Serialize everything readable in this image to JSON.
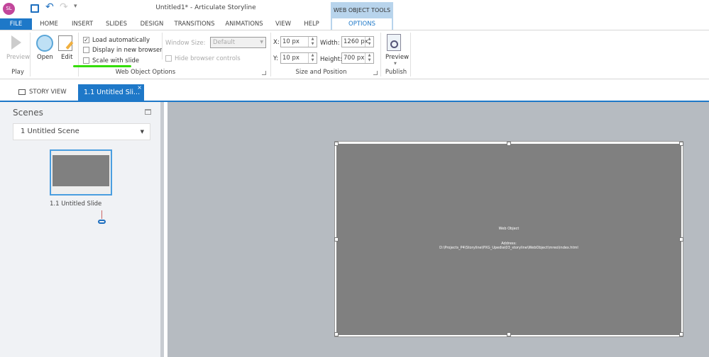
{
  "titlebar": {
    "logo": "SL",
    "title": "Untitled1* -  Articulate Storyline",
    "icons": [
      "save-icon",
      "undo-icon",
      "redo-icon",
      "customize-icon"
    ]
  },
  "contextual_header": "WEB OBJECT TOOLS",
  "tabs": [
    "FILE",
    "HOME",
    "INSERT",
    "SLIDES",
    "DESIGN",
    "TRANSITIONS",
    "ANIMATIONS",
    "VIEW",
    "HELP",
    "OPTIONS"
  ],
  "ribbon": {
    "preview": "Preview",
    "play_group": "Play",
    "open": "Open",
    "edit": "Edit",
    "load_auto": "Load automatically",
    "load_auto_checked": true,
    "new_browser": "Display in new browser",
    "new_browser_checked": false,
    "scale": "Scale with slide",
    "scale_checked": false,
    "window_size_label": "Window Size:",
    "window_size_value": "Default",
    "hide_controls": "Hide browser controls",
    "wo_group": "Web Object Options",
    "x_label": "X:",
    "x_value": "10 px",
    "y_label": "Y:",
    "y_value": "10 px",
    "width_label": "Width:",
    "width_value": "1260 px",
    "height_label": "Height:",
    "height_value": "700 px",
    "size_group": "Size and Position",
    "publish_preview": "Preview",
    "publish_group": "Publish",
    "highlight_color": "#33dd00"
  },
  "doc_tabs": {
    "story_view": "STORY VIEW",
    "slide_tab": "1.1 Untitled Sli..."
  },
  "scenes": {
    "title": "Scenes",
    "selected": "1 Untitled Scene",
    "slide_label": "1.1 Untitled Slide"
  },
  "slide": {
    "web_object": "Web Object",
    "address_label": "Address:",
    "address": "D:\\Projects_P4\\Storyline\\PXG_Upedia\\03_storyline\\WebObject\\mreo\\index.html"
  }
}
